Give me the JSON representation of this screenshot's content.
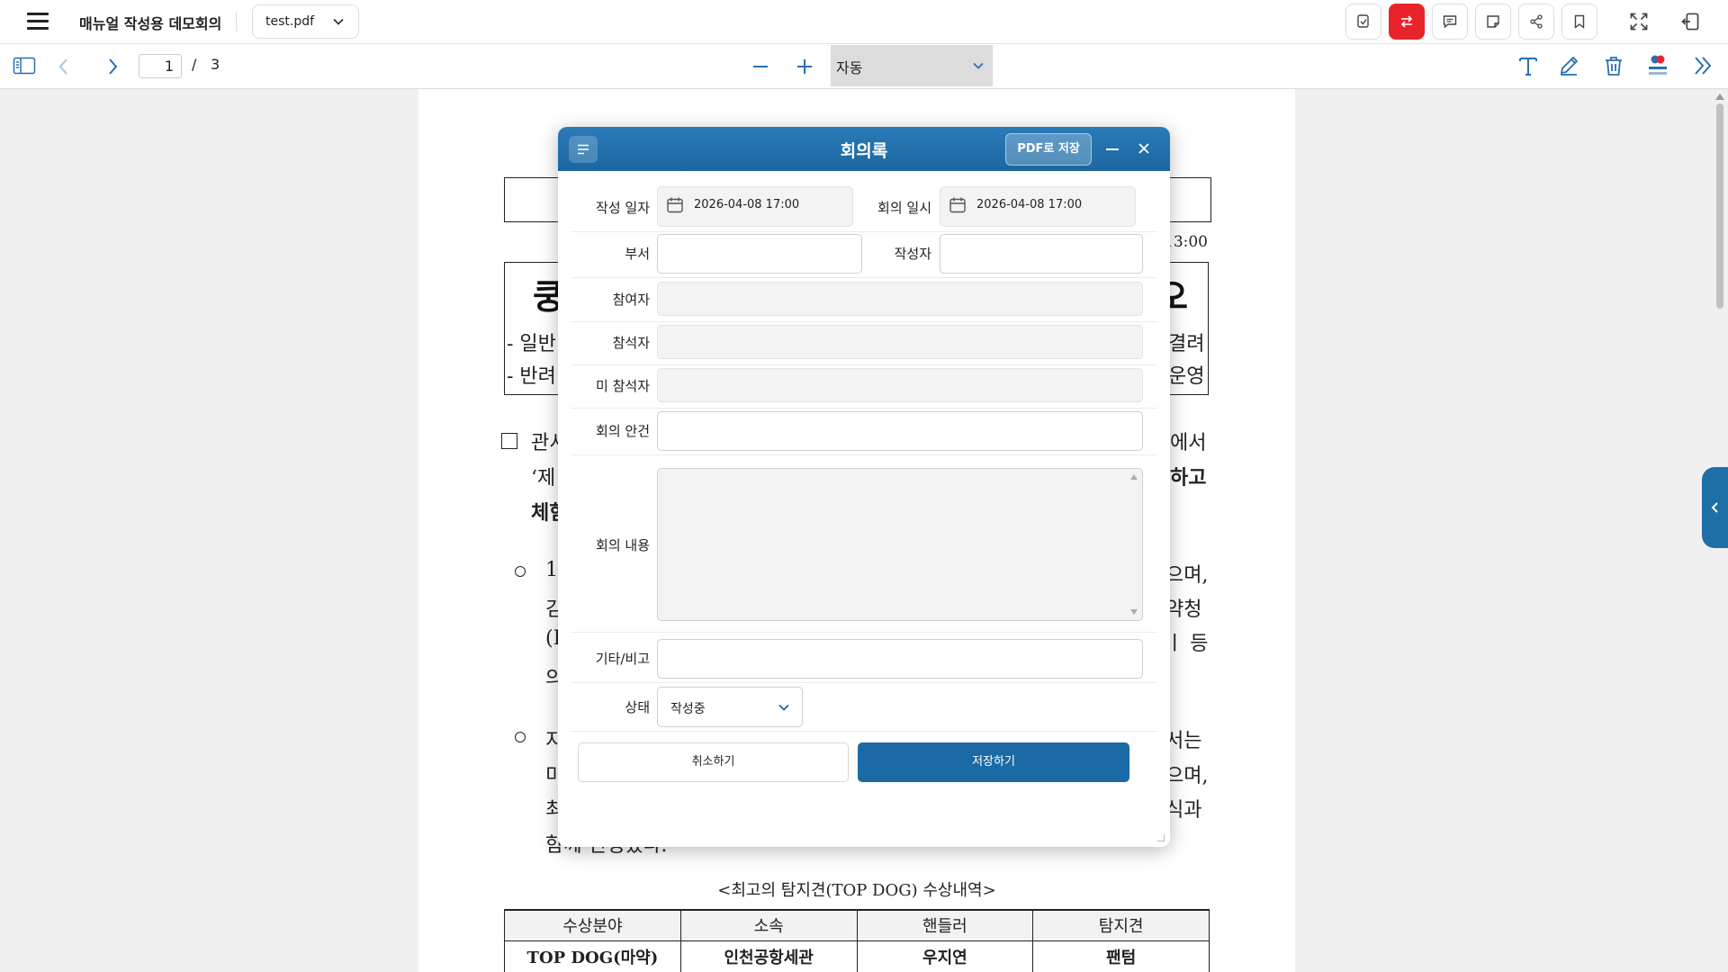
{
  "app": {
    "title": "매뉴얼 작성용 데모회의",
    "file_name": "test.pdf"
  },
  "top_icons": [
    "note-check-icon",
    "swap-icon",
    "comment-icon",
    "sticky-note-icon",
    "share-icon",
    "bookmark-icon",
    "fullscreen-icon",
    "exit-icon"
  ],
  "colors": {
    "accent_red": "#e8242a",
    "modal_header": "#1b66a1",
    "save_button": "#1b6aa5"
  },
  "viewer": {
    "page_current": "1",
    "page_separator": "/",
    "page_total": "3",
    "zoom_value": "자동"
  },
  "document": {
    "time_fragment": "13:00",
    "heading_left": "쿵",
    "heading_right": "오",
    "bullet_line1_left": "- 일반",
    "bullet_line1_right": "결려",
    "bullet_line2_left": "- 반려",
    "bullet_line2_right": "운영",
    "para1_line1_left": "관서",
    "para1_line1_right": "에서",
    "para1_line2_left": "‘제",
    "para1_line2_right": "하고",
    "para1_line3_left": "체험",
    "item1_line1_left": "1",
    "item1_line1_right": "으며,",
    "item1_line2_left": "김",
    "item1_line2_right": "약청",
    "item1_line3_left": "(I",
    "item1_line3_right": "ㅣ 등",
    "item1_line4_left": "의",
    "item2_line1_left": "지",
    "item2_line1_right": "서는",
    "item2_line2_left": "미",
    "item2_line2_right": "으며,",
    "item2_line3_left": "최",
    "item2_line3_right": "식과",
    "item2_line4_left": "함께 진행했다.",
    "caption": "<최고의 탐지견(TOP DOG) 수상내역>",
    "table_headers": [
      "수상분야",
      "소속",
      "핸들러",
      "탐지견"
    ],
    "table_rows": [
      [
        "TOP DOG(마약)",
        "인천공항세관",
        "우지연",
        "팬텀"
      ]
    ]
  },
  "modal": {
    "title": "회의록",
    "pdf_button": "PDF로 저장",
    "fields": {
      "written_date_label": "작성 일자",
      "written_date_value": "2026-04-08 17:00",
      "meeting_date_label": "회의 일시",
      "meeting_date_value": "2026-04-08 17:00",
      "department_label": "부서",
      "department_value": "",
      "author_label": "작성자",
      "author_value": "",
      "participants_label": "참여자",
      "attendees_label": "참석자",
      "absentees_label": "미 참석자",
      "agenda_label": "회의 안건",
      "agenda_value": "",
      "content_label": "회의 내용",
      "content_value": "",
      "etc_label": "기타/비고",
      "etc_value": "",
      "status_label": "상태",
      "status_value": "작성중"
    },
    "cancel_button": "취소하기",
    "save_button": "저장하기"
  }
}
